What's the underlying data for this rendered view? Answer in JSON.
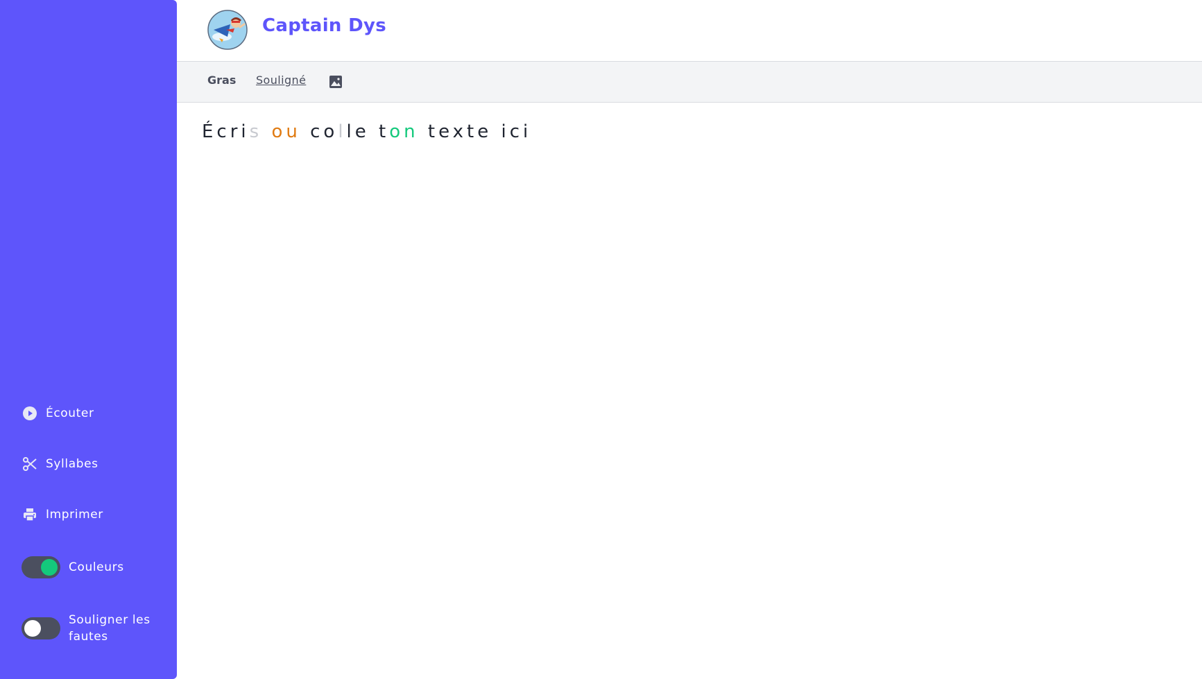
{
  "app": {
    "name": "Captain Dys"
  },
  "sidebar": {
    "actions": [
      {
        "label": "Écouter",
        "icon": "play-circle-icon"
      },
      {
        "label": "Syllabes",
        "icon": "scissors-icon"
      },
      {
        "label": "Imprimer",
        "icon": "printer-icon"
      }
    ],
    "toggles": [
      {
        "label": "Couleurs",
        "state": "on"
      },
      {
        "label": "Souligner les fautes",
        "state": "off"
      }
    ]
  },
  "toolbar": {
    "bold_label": "Gras",
    "underline_label": "Souligné",
    "image_icon": "image-icon"
  },
  "editor": {
    "placeholder_text": "Écris ou colle ton texte ici",
    "placeholder_segments": [
      {
        "text": "Écri",
        "color": "#1f2430"
      },
      {
        "text": "s",
        "color": "#c8cad0"
      },
      {
        "text": " ",
        "color": "#1f2430"
      },
      {
        "text": "ou",
        "color": "#e07b12"
      },
      {
        "text": " co",
        "color": "#1f2430"
      },
      {
        "text": "l",
        "color": "#c8cad0"
      },
      {
        "text": "le t",
        "color": "#1f2430"
      },
      {
        "text": "on",
        "color": "#14c97c"
      },
      {
        "text": " texte ici",
        "color": "#1f2430"
      }
    ]
  },
  "colors": {
    "sidebar_bg": "#5e55fb",
    "brand": "#5e55fb",
    "toggle_on": "#14c97c",
    "toggle_track": "#4b4f5f"
  }
}
